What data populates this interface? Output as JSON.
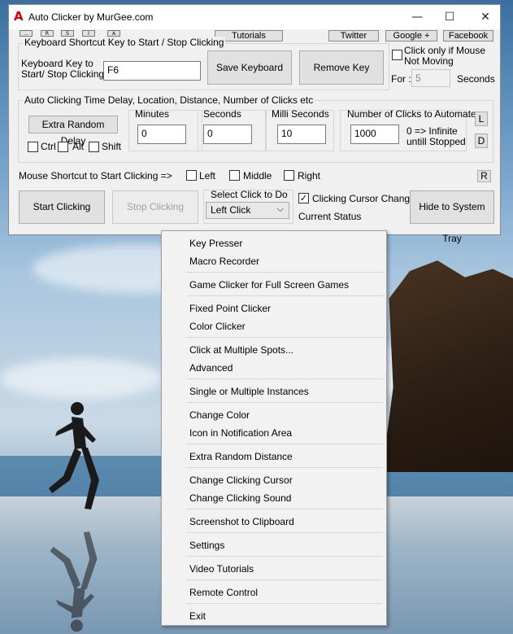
{
  "window": {
    "title": "Auto Clicker by MurGee.com",
    "app_icon": "A",
    "controls": {
      "minimize": "—",
      "maximize": "☐",
      "close": "✕"
    }
  },
  "top_buttons": {
    "small": [
      "...",
      "R",
      "S",
      "I",
      "A"
    ],
    "tutorials": "Tutorials",
    "twitter": "Twitter",
    "google": "Google +",
    "facebook": "Facebook"
  },
  "keyboard_group": {
    "title": "Keyboard Shortcut Key to Start / Stop Clicking",
    "key_label_line1": "Keyboard Key to",
    "key_label_line2": "Start/ Stop Clicking :",
    "key_value": "F6",
    "save_button": "Save Keyboard Key",
    "remove_button": "Remove Key"
  },
  "mouse_not_moving": {
    "label_line1": "Click only if Mouse",
    "label_line2": "Not Moving",
    "checked": false,
    "for_label": "For :",
    "for_value": "5",
    "seconds_label": "Seconds"
  },
  "timing_group": {
    "title": "Auto Clicking Time Delay, Location, Distance, Number of Clicks etc",
    "extra_random_delay": "Extra Random Delay",
    "ctrl": "Ctrl",
    "alt": "Alt",
    "shift": "Shift",
    "minutes_label": "Minutes",
    "minutes_value": "0",
    "seconds_label": "Seconds",
    "seconds_value": "0",
    "milli_label": "Milli Seconds",
    "milli_value": "10",
    "clicks_label": "Number of Clicks to Automate",
    "clicks_value": "1000",
    "infinite_line1": "0 => Infinite",
    "infinite_line2": "untill Stopped",
    "l_button": "L",
    "d_button": "D"
  },
  "mouse_shortcut": {
    "label": "Mouse Shortcut to Start Clicking =>",
    "left": "Left",
    "middle": "Middle",
    "right": "Right",
    "r_button": "R"
  },
  "bottom": {
    "start": "Start Clicking",
    "stop": "Stop Clicking",
    "select_label": "Select Click to Do",
    "select_value": "Left Click",
    "cursor_change": "Clicking Cursor Change",
    "cursor_change_checked": true,
    "current_status": "Current Status",
    "hide_tray": "Hide to System Tray"
  },
  "menu": {
    "items": [
      "Key Presser",
      "Macro Recorder",
      "Game Clicker for Full Screen Games",
      "Fixed Point Clicker",
      "Color Clicker",
      "Click at Multiple Spots...",
      "Advanced",
      "Single or Multiple Instances",
      "Change Color",
      "Icon in Notification Area",
      "Extra Random Distance",
      "Change Clicking Cursor",
      "Change Clicking Sound",
      "Screenshot to Clipboard",
      "Settings",
      "Video Tutorials",
      "Remote Control",
      "Exit"
    ]
  }
}
